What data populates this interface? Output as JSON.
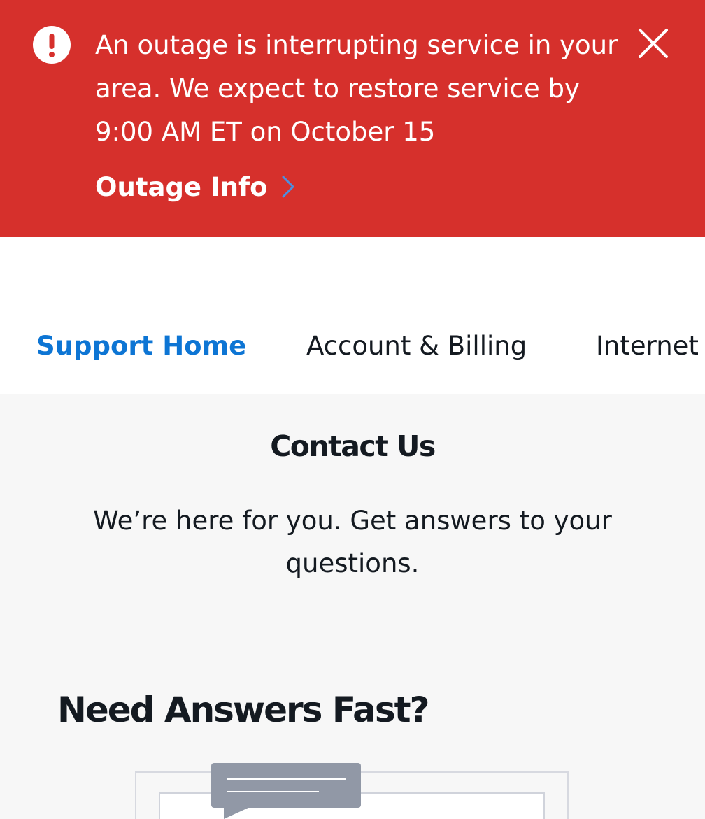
{
  "banner": {
    "message": "An outage is interrupting service in your area. We expect to restore service by 9:00 AM ET on October 15",
    "link_label": "Outage Info",
    "icon": "alert-exclamation-icon",
    "close_icon": "close-icon",
    "color": "#d6302c"
  },
  "nav": {
    "tabs": [
      {
        "label": "Support Home",
        "active": true
      },
      {
        "label": "Account & Billing",
        "active": false
      },
      {
        "label": "Internet",
        "active": false
      }
    ],
    "active_color": "#0d75d4"
  },
  "contact": {
    "title": "Contact Us",
    "subtitle": "We’re here for you. Get answers to your questions."
  },
  "section": {
    "title": "Need Answers Fast?",
    "illustration_icon": "chat-bubble-illustration"
  }
}
